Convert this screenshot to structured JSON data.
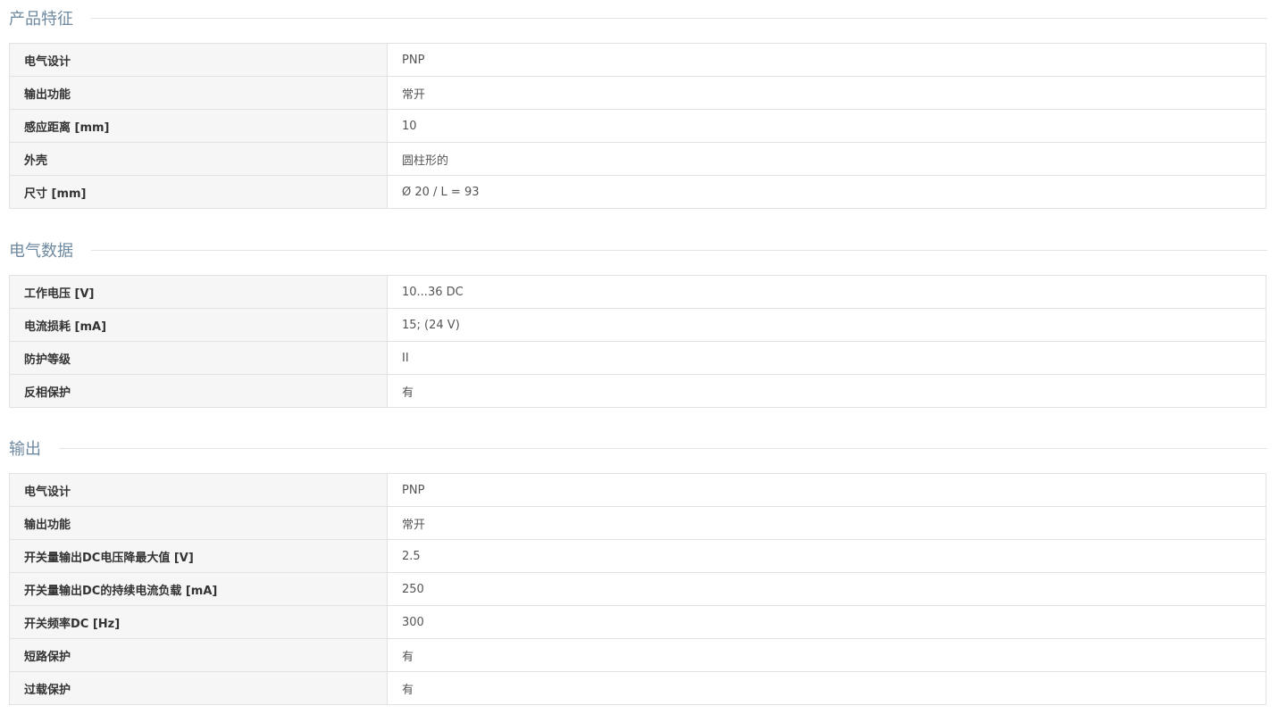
{
  "sections": [
    {
      "title": "产品特征",
      "rows": [
        {
          "label": "电气设计",
          "value": "PNP"
        },
        {
          "label": "输出功能",
          "value": "常开"
        },
        {
          "label": "感应距离 [mm]",
          "value": "10"
        },
        {
          "label": "外壳",
          "value": "圆柱形的"
        },
        {
          "label": "尺寸 [mm]",
          "value": "Ø 20 / L = 93"
        }
      ]
    },
    {
      "title": "电气数据",
      "rows": [
        {
          "label": "工作电压 [V]",
          "value": "10...36 DC"
        },
        {
          "label": "电流损耗 [mA]",
          "value": "15; (24 V)"
        },
        {
          "label": "防护等级",
          "value": "II"
        },
        {
          "label": "反相保护",
          "value": "有"
        }
      ]
    },
    {
      "title": "输出",
      "rows": [
        {
          "label": "电气设计",
          "value": "PNP"
        },
        {
          "label": "输出功能",
          "value": "常开"
        },
        {
          "label": "开关量输出DC电压降最大值 [V]",
          "value": "2.5"
        },
        {
          "label": "开关量输出DC的持续电流负载 [mA]",
          "value": "250"
        },
        {
          "label": "开关频率DC [Hz]",
          "value": "300"
        },
        {
          "label": "短路保护",
          "value": "有"
        },
        {
          "label": "过载保护",
          "value": "有"
        }
      ]
    }
  ]
}
